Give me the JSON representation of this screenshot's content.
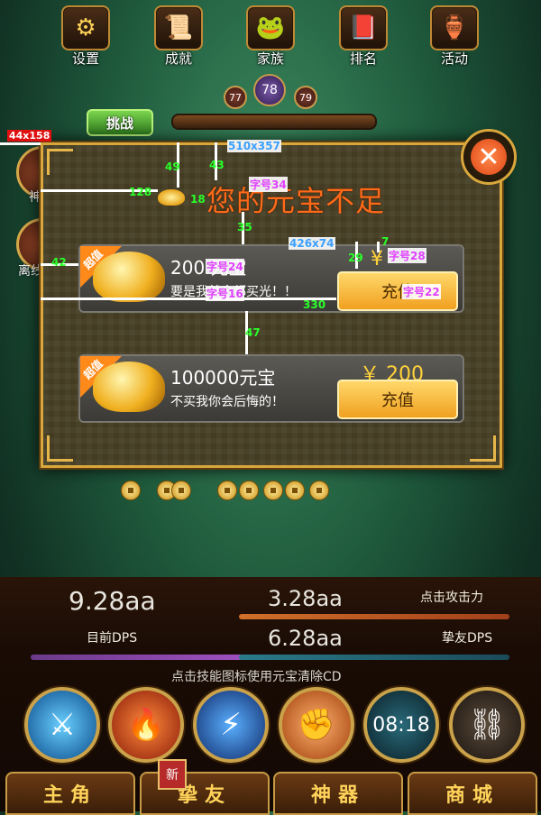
{
  "top_menu": [
    {
      "label": "设置",
      "icon": "gear-icon"
    },
    {
      "label": "成就",
      "icon": "scroll-icon"
    },
    {
      "label": "家族",
      "icon": "frog-icon"
    },
    {
      "label": "排名",
      "icon": "book-icon"
    },
    {
      "label": "活动",
      "icon": "treasure-icon"
    }
  ],
  "levels": {
    "prev": "77",
    "current": "78",
    "next": "79"
  },
  "challenge_label": "挑战",
  "side_labels": {
    "first": "神",
    "second": "离线"
  },
  "dialog": {
    "title": "您的元宝不足",
    "offers": [
      {
        "tag": "超值",
        "amount": "200 元宝",
        "desc": "要是我就全都买光！！",
        "price": "¥",
        "button": "充值"
      },
      {
        "tag": "超值",
        "amount": "100000元宝",
        "desc": "不买我你会后悔的！",
        "price": "￥ 200",
        "button": "充值"
      }
    ]
  },
  "annotations": {
    "sizes": [
      "44x158",
      "510x357",
      "426x74"
    ],
    "numbers": [
      "49",
      "43",
      "128",
      "18",
      "35",
      "42",
      "7",
      "29",
      "330",
      "47"
    ],
    "fonts": [
      "字号34",
      "字号24",
      "字号16",
      "字号28",
      "字号22"
    ]
  },
  "stats": {
    "current_dps_value": "9.28aa",
    "current_dps_label": "目前DPS",
    "click_attack_value": "3.28aa",
    "click_attack_label": "点击攻击力",
    "friend_dps_value": "6.28aa",
    "friend_dps_label": "挚友DPS"
  },
  "skills_hint": "点击技能图标使用元宝清除CD",
  "skill_timer": "08:18",
  "skills": [
    "blade-skill-icon",
    "hero-skill-icon",
    "warrior-skill-icon",
    "fist-skill-icon",
    "timer-skill-icon",
    "chain-skill-icon"
  ],
  "tabs": [
    "主角",
    "挚友",
    "神器",
    "商城"
  ],
  "new_badge": "新",
  "colors": {
    "title": "#ff6a1a",
    "price": "#ffd23a",
    "button": "#f0a020",
    "frame": "#d9a73c"
  }
}
